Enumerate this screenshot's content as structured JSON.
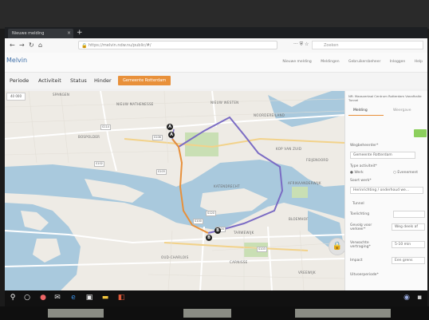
{
  "browser": {
    "tab_title": "Nieuwe melding",
    "new_tab": "+",
    "url": "https://melvin.ndw.nu/public/#/",
    "search_placeholder": "Zoeken"
  },
  "app": {
    "name": "Melvin",
    "top_links": [
      "Nieuwe melding",
      "Meldingen",
      "Gebruikersbeheer",
      "Inloggen",
      "Help"
    ]
  },
  "menu": {
    "items": [
      "Periode",
      "Activiteit",
      "Status",
      "Hinder"
    ],
    "active_item": "Gemeente Rotterdam"
  },
  "map": {
    "zoom_label": "40 000",
    "places": [
      "SPANGEN",
      "NIEUW MATHENESSE",
      "BOSPOLDER",
      "NIEUW WESTEN",
      "NOORDEREILAND",
      "KOP VAN ZUID",
      "KATENDRECHT",
      "FEIJENOORD",
      "AFRIKAANDERWIJK",
      "TARWEWIJK",
      "BLOEMHOF",
      "OUD-CHARLOIS",
      "CARNISSE",
      "VREEWIJK"
    ],
    "roads": [
      "S114",
      "S106",
      "S102",
      "S103",
      "S120",
      "S100",
      "S104",
      "S103"
    ],
    "markers": [
      "A",
      "B"
    ]
  },
  "panel": {
    "header": "NR: Maasvertaal Centrum Rotterdam Vanafhalte Tunnel",
    "tabs": [
      "Melding",
      "Weergave"
    ],
    "wegbeheerder_label": "Wegbeheerder*",
    "wegbeheerder_value": "Gemeente Rotterdam",
    "type_label": "Type activiteit*",
    "type_options": [
      "Werk",
      "Evenement"
    ],
    "soort_label": "Soort werk*",
    "soort_value": "Herinrichting / onderhoud we...",
    "tunnel_value": "Tunnel",
    "toelichting_label": "Toelichting",
    "fields": [
      {
        "label": "Gevolg voor verkeer*",
        "value": "Weg deels af"
      },
      {
        "label": "Verwachte vertraging*",
        "value": "5-10 min"
      },
      {
        "label": "Impact",
        "value": "Een grens"
      },
      {
        "label": "Uitvoerperiode*",
        "value": ""
      }
    ]
  },
  "colors": {
    "accent": "#e8903a",
    "water": "#a9c9dd",
    "route_purple": "#7b6cc4",
    "route_orange": "#e8903a"
  }
}
